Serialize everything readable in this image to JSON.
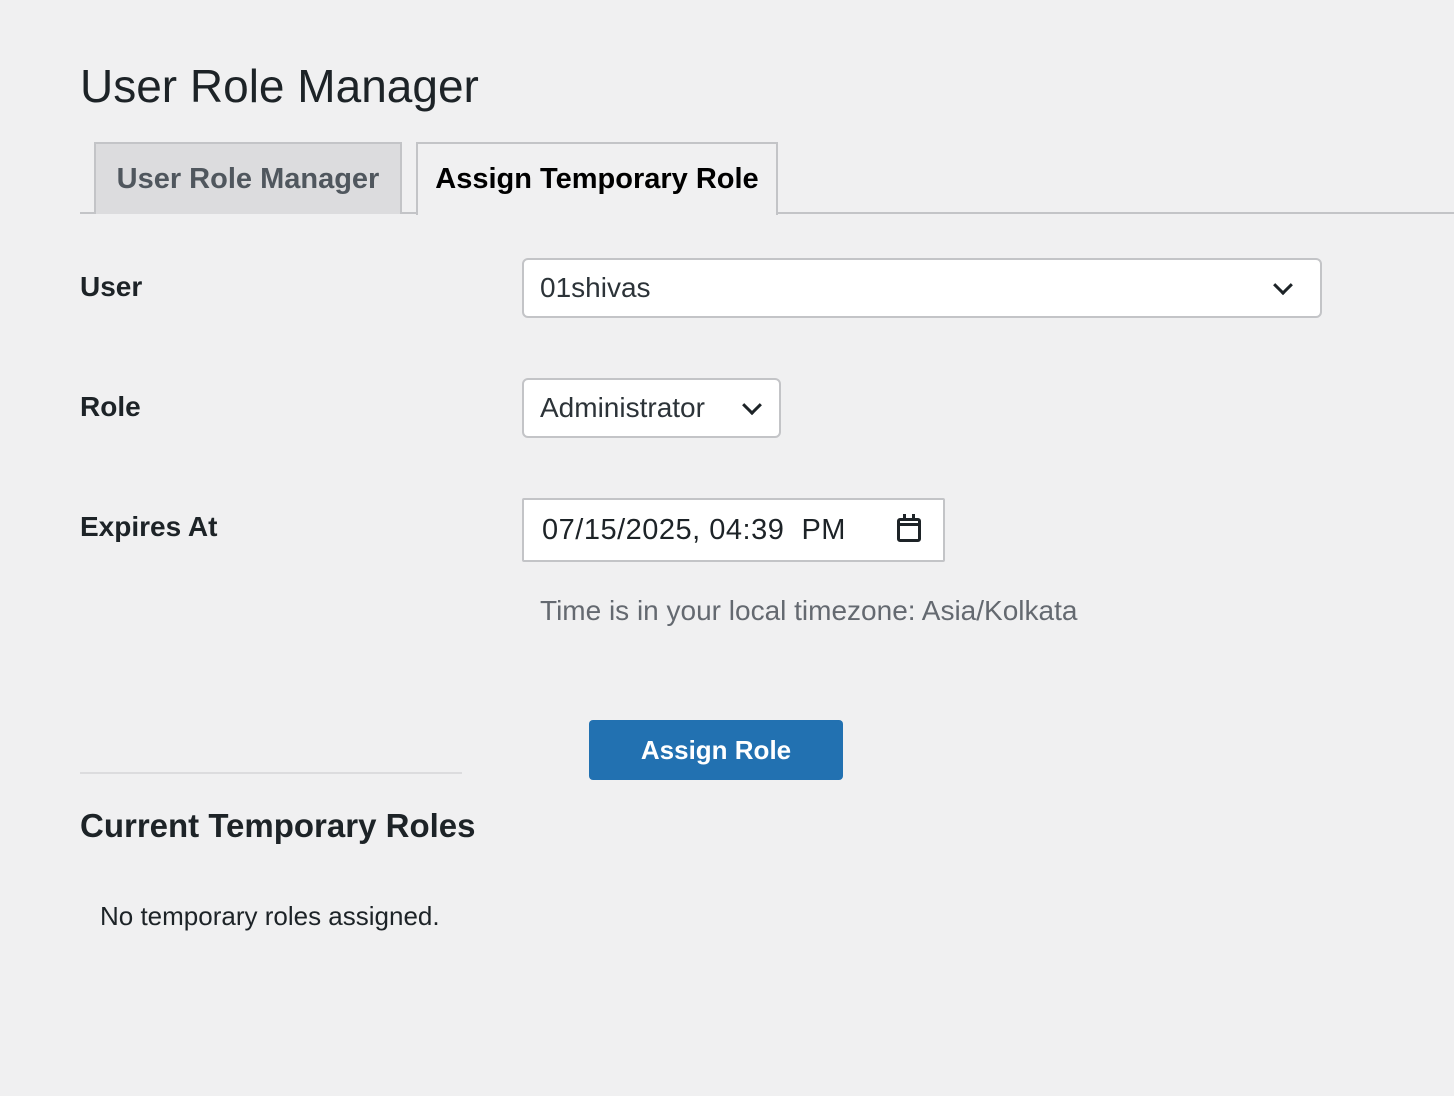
{
  "page": {
    "title": "User Role Manager"
  },
  "tabs": [
    {
      "label": "User Role Manager",
      "active": false
    },
    {
      "label": "Assign Temporary Role",
      "active": true
    }
  ],
  "form": {
    "user": {
      "label": "User",
      "value": "01shivas"
    },
    "role": {
      "label": "Role",
      "value": "Administrator"
    },
    "expires": {
      "label": "Expires At",
      "value": "07/15/2025, 04:39  PM",
      "hint": "Time is in your local timezone: Asia/Kolkata"
    },
    "submit_label": "Assign Role"
  },
  "current": {
    "title": "Current Temporary Roles",
    "empty_message": "No temporary roles assigned."
  },
  "icons": {
    "select_arrow": "chevron-down-icon",
    "date_picker": "calendar-icon"
  },
  "colors": {
    "background": "#f0f0f1",
    "primary_button": "#2271b1",
    "text": "#1d2327",
    "hint_text": "#646970"
  }
}
